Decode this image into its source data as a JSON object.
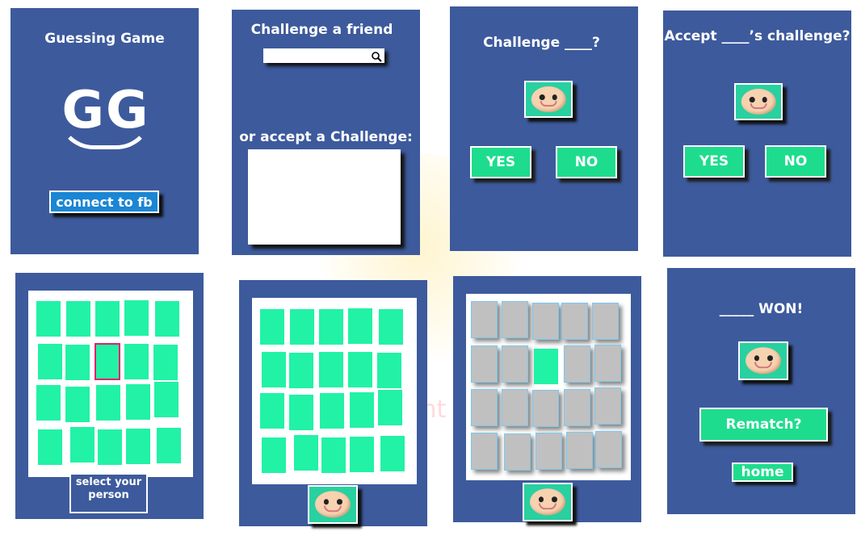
{
  "colors": {
    "panel": "#3d5a9c",
    "accent_green": "#1edc8e",
    "card_green": "#21f2a6",
    "card_gray": "#c0c0c0",
    "fb_blue": "#1b86d4",
    "selection": "#e0206e"
  },
  "screen1": {
    "title": "Guessing Game",
    "logo": "GG",
    "connect_button": "connect to fb"
  },
  "screen2": {
    "title": "Challenge a friend",
    "search_icon": "search-icon",
    "accept_label": "or accept a Challenge:"
  },
  "screen3": {
    "title": "Challenge ____?",
    "yes": "YES",
    "no": "NO"
  },
  "screen4": {
    "title": "Accept ____’s challenge?",
    "yes": "YES",
    "no": "NO"
  },
  "screen5": {
    "select_label_1": "select your",
    "select_label_2": "person"
  },
  "screen8": {
    "title": "_____ WON!",
    "rematch": "Rematch?",
    "home": "home"
  },
  "watermark": {
    "text": "Paint 2"
  }
}
